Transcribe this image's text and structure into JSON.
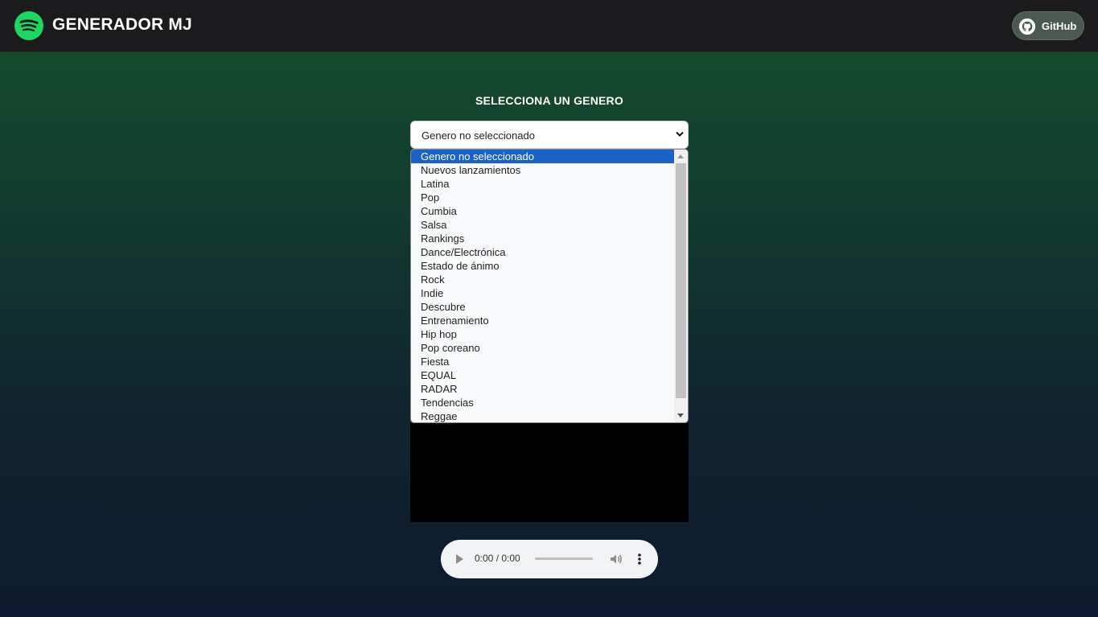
{
  "header": {
    "brand": "GENERADOR MJ",
    "github_label": "GitHub",
    "colors": {
      "logo": "#1ed760",
      "navbar": "#1b1b1d"
    }
  },
  "main": {
    "title": "SELECCIONA UN GENERO",
    "select": {
      "value": "Genero no seleccionado",
      "options": [
        "Genero no seleccionado",
        "Nuevos lanzamientos",
        "Latina",
        "Pop",
        "Cumbia",
        "Salsa",
        "Rankings",
        "Dance/Electrónica",
        "Estado de ánimo",
        "Rock",
        "Indie",
        "Descubre",
        "Entrenamiento",
        "Hip hop",
        "Pop coreano",
        "Fiesta",
        "EQUAL",
        "RADAR",
        "Tendencias",
        "Reggae"
      ],
      "highlighted_color": "#1b62c8"
    }
  },
  "player": {
    "time": "0:00 / 0:00",
    "icons": [
      "play-icon",
      "volume-icon",
      "more-options-icon"
    ]
  }
}
